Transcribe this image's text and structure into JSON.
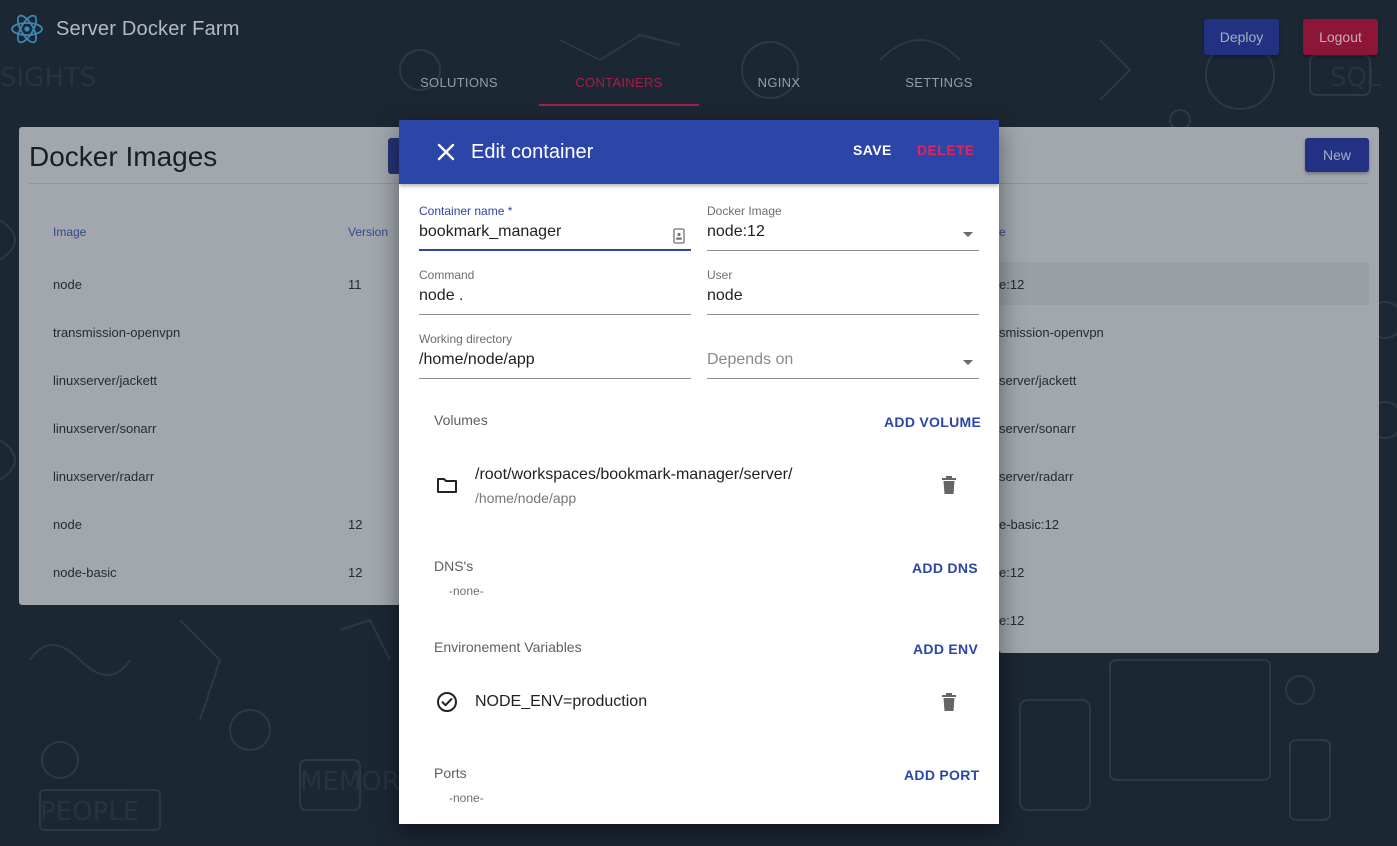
{
  "app": {
    "title": "Server Docker Farm",
    "deploy_label": "Deploy",
    "logout_label": "Logout"
  },
  "tabs": [
    {
      "label": "SOLUTIONS",
      "active": false
    },
    {
      "label": "CONTAINERS",
      "active": true
    },
    {
      "label": "NGINX",
      "active": false
    },
    {
      "label": "SETTINGS",
      "active": false
    }
  ],
  "background_page": {
    "title": "Docker Images",
    "new_label": "New",
    "columns": {
      "image": "Image",
      "version": "Version",
      "right_col_fragment": "e"
    },
    "rows": [
      {
        "image": "node",
        "version": "11",
        "right": "e:12"
      },
      {
        "image": "transmission-openvpn",
        "version": "",
        "right": "smission-openvpn"
      },
      {
        "image": "linuxserver/jackett",
        "version": "",
        "right": "server/jackett"
      },
      {
        "image": "linuxserver/sonarr",
        "version": "",
        "right": "server/sonarr"
      },
      {
        "image": "linuxserver/radarr",
        "version": "",
        "right": "server/radarr"
      },
      {
        "image": "node",
        "version": "12",
        "right": "e-basic:12"
      },
      {
        "image": "node-basic",
        "version": "12",
        "right": "e:12"
      },
      {
        "right": "e:12"
      }
    ]
  },
  "dialog": {
    "title": "Edit container",
    "save_label": "SAVE",
    "delete_label": "DELETE",
    "fields": {
      "container_name": {
        "label": "Container name *",
        "value": "bookmark_manager"
      },
      "docker_image": {
        "label": "Docker Image",
        "value": "node:12"
      },
      "command": {
        "label": "Command",
        "value": "node ."
      },
      "user": {
        "label": "User",
        "value": "node"
      },
      "working_directory": {
        "label": "Working directory",
        "value": "/home/node/app"
      },
      "depends_on": {
        "placeholder": "Depends on"
      }
    },
    "volumes": {
      "title": "Volumes",
      "add_label": "ADD VOLUME",
      "items": [
        {
          "host": "/root/workspaces/bookmark-manager/server/",
          "container": "/home/node/app",
          "icon": "folder-icon"
        }
      ]
    },
    "dns": {
      "title": "DNS's",
      "add_label": "ADD DNS",
      "empty": "-none-"
    },
    "env": {
      "title": "Environement Variables",
      "add_label": "ADD ENV",
      "items": [
        {
          "value": "NODE_ENV=production",
          "icon": "check-circle-icon"
        }
      ]
    },
    "ports": {
      "title": "Ports",
      "add_label": "ADD PORT",
      "empty": "-none-"
    }
  },
  "colors": {
    "primary": "#2b45a8",
    "accent": "#d21e53",
    "background": "#1e2a36"
  }
}
